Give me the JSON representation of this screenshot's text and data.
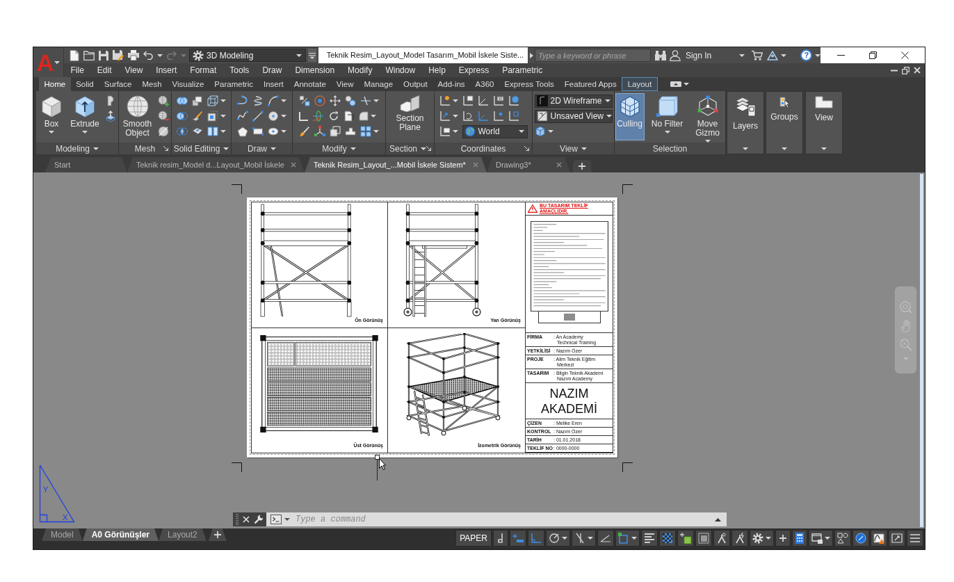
{
  "app": {
    "logo": "A"
  },
  "title_bar": {
    "workspace": "3D Modeling",
    "document_title": "Teknik Resim_Layout_Model Tasarım_Mobil İskele Siste...",
    "search": {
      "placeholder": "Type a keyword or phrase"
    },
    "sign_in": "Sign In",
    "help": "?"
  },
  "menu_bar": [
    "File",
    "Edit",
    "View",
    "Insert",
    "Format",
    "Tools",
    "Draw",
    "Dimension",
    "Modify",
    "Window",
    "Help",
    "Express",
    "Parametric"
  ],
  "ribbon": {
    "tabs": [
      {
        "label": "Home",
        "kind": "standard",
        "selected": true
      },
      {
        "label": "Solid",
        "kind": "standard",
        "selected": false
      },
      {
        "label": "Surface",
        "kind": "standard",
        "selected": false
      },
      {
        "label": "Mesh",
        "kind": "standard",
        "selected": false
      },
      {
        "label": "Visualize",
        "kind": "standard",
        "selected": false
      },
      {
        "label": "Parametric",
        "kind": "standard",
        "selected": false
      },
      {
        "label": "Insert",
        "kind": "standard",
        "selected": false
      },
      {
        "label": "Annotate",
        "kind": "standard",
        "selected": false
      },
      {
        "label": "View",
        "kind": "standard",
        "selected": false
      },
      {
        "label": "Manage",
        "kind": "standard",
        "selected": false
      },
      {
        "label": "Output",
        "kind": "standard",
        "selected": false
      },
      {
        "label": "Add-ins",
        "kind": "standard",
        "selected": false
      },
      {
        "label": "A360",
        "kind": "standard",
        "selected": false
      },
      {
        "label": "Express Tools",
        "kind": "standard",
        "selected": false
      },
      {
        "label": "Featured Apps",
        "kind": "standard",
        "selected": false
      },
      {
        "label": "Layout",
        "kind": "contextual",
        "selected": false
      }
    ],
    "panels": [
      {
        "kind": "expanded",
        "title": "Modeling",
        "menu": true,
        "launcher": false,
        "buttons": [
          {
            "label": "Box",
            "menu": true
          },
          {
            "label": "Extrude",
            "menu": true
          }
        ]
      },
      {
        "kind": "expanded",
        "title": "Mesh",
        "menu": false,
        "launcher": true,
        "buttons": [
          {
            "label": "Smooth Object",
            "menu": false
          }
        ]
      },
      {
        "kind": "expanded",
        "title": "Solid Editing",
        "menu": true,
        "launcher": false
      },
      {
        "kind": "expanded",
        "title": "Draw",
        "menu": true,
        "launcher": false
      },
      {
        "kind": "expanded",
        "title": "Modify",
        "menu": true,
        "launcher": false
      },
      {
        "kind": "expanded",
        "title": "Section",
        "menu": true,
        "launcher": true,
        "buttons": [
          {
            "label": "Section Plane",
            "menu": false
          }
        ]
      },
      {
        "kind": "expanded",
        "title": "Coordinates",
        "menu": false,
        "launcher": true,
        "dropdowns": [
          {
            "value": "World"
          }
        ]
      },
      {
        "kind": "expanded",
        "title": "View",
        "menu": true,
        "launcher": false,
        "dropdowns": [
          {
            "value": "2D Wireframe"
          },
          {
            "value": "Unsaved View"
          }
        ]
      },
      {
        "kind": "expanded",
        "title": "Selection",
        "menu": false,
        "launcher": false,
        "buttons": [
          {
            "label": "Culling",
            "menu": false,
            "on": true
          },
          {
            "label": "No Filter",
            "menu": true,
            "on": false
          },
          {
            "label": "Move Gizmo",
            "menu": true,
            "on": false
          }
        ]
      },
      {
        "kind": "collapsed",
        "title": "Layers"
      },
      {
        "kind": "collapsed",
        "title": "Groups"
      },
      {
        "kind": "collapsed",
        "title": "View"
      }
    ]
  },
  "file_tabs": [
    {
      "label": "Start",
      "selected": false,
      "closable": false
    },
    {
      "label": "Teknik resim_Model d...Layout_Mobil İskele",
      "selected": false,
      "closable": true
    },
    {
      "label": "Teknik Resim_Layout_...Mobil İskele Sistem*",
      "selected": true,
      "closable": true
    },
    {
      "label": "Drawing3*",
      "selected": false,
      "closable": true
    }
  ],
  "sheet": {
    "views": [
      {
        "kind": "front",
        "label": "Ön Görünüş"
      },
      {
        "kind": "side",
        "label": "Yan Görünüş"
      },
      {
        "kind": "top",
        "label": "Üst Görünüş"
      },
      {
        "kind": "isometric",
        "label": "İzometrik Görünüş"
      }
    ],
    "title_block": {
      "notice": "BU TASARIM TEKLİF AMAÇLIDIR.",
      "project_fields": [
        {
          "label": "FİRMA",
          "value": ": An Academy\nTechnical Training"
        },
        {
          "label": "YETKİLİSİ",
          "value": ": Nazım Özer"
        },
        {
          "label": "PROJE",
          "value": ": Alim Teknik Eğitim Merkezi"
        },
        {
          "label": "TASARIM",
          "value": ": Bilgin Teknik Akademi\nNazım Academy"
        }
      ],
      "company": "NAZIM AKADEMİ",
      "drawing_fields": [
        {
          "label": "ÇİZEN",
          "value": ": Melike Eren"
        },
        {
          "label": "KONTROL",
          "value": ": Nazım Özer"
        },
        {
          "label": "TARİH",
          "value": ": 01.01.2018"
        },
        {
          "label": "TEKLİF NO",
          "value": ": 0000-0000"
        }
      ]
    }
  },
  "ucs_icon": {
    "x_label": "X",
    "y_label": "Y"
  },
  "command_line": {
    "placeholder": "Type a command"
  },
  "layout_tabs": [
    {
      "label": "Model",
      "selected": false
    },
    {
      "label": "A0 Görünüşler",
      "selected": true
    },
    {
      "label": "Layout2",
      "selected": false
    }
  ],
  "status_bar": {
    "space": "PAPER",
    "toggles": [
      {
        "on": false
      },
      {
        "on": true
      },
      {
        "on": true
      },
      {
        "on": false
      },
      {
        "on": false
      },
      {
        "on": false
      },
      {
        "on": true
      },
      {
        "on": false
      },
      {
        "on": true
      },
      {
        "on": false
      }
    ]
  }
}
